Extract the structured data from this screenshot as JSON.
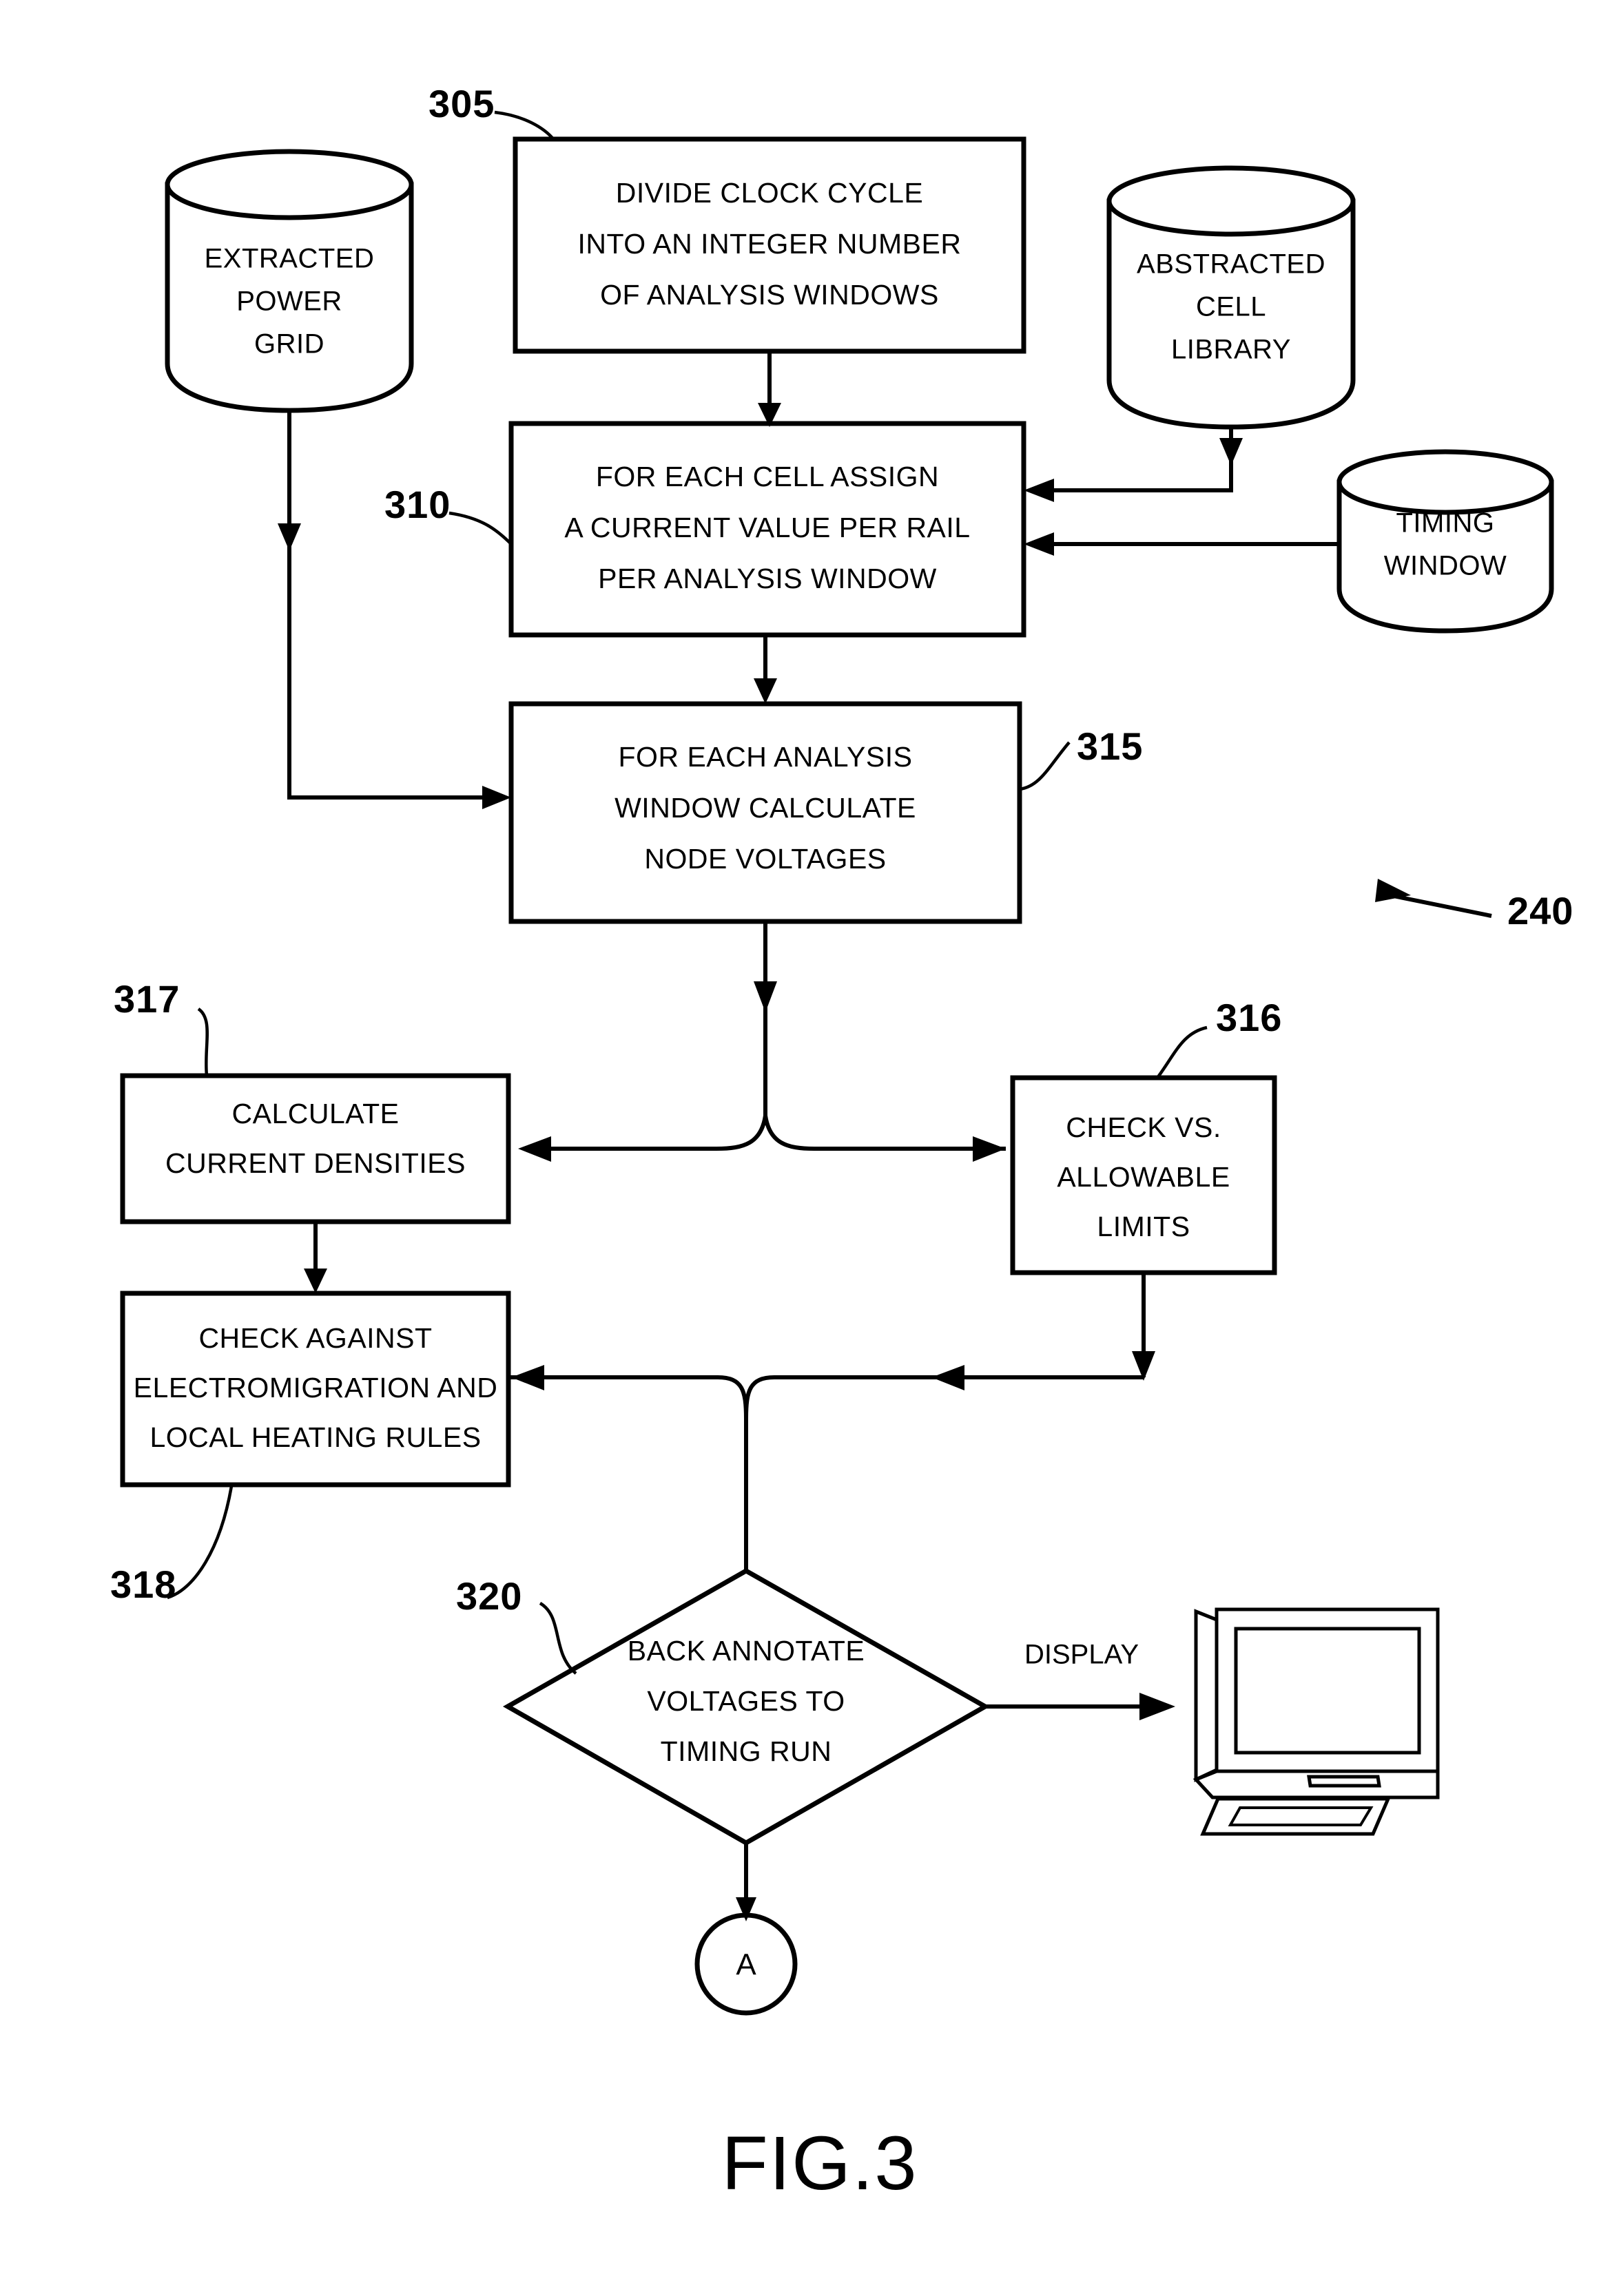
{
  "figure": {
    "caption": "FIG.3",
    "overall_ref": "240"
  },
  "databases": [
    {
      "id": "extracted-power-grid",
      "ref": "",
      "lines": [
        "EXTRACTED",
        "POWER",
        "GRID"
      ]
    },
    {
      "id": "abstracted-cell-library",
      "ref": "",
      "lines": [
        "ABSTRACTED",
        "CELL",
        "LIBRARY"
      ]
    },
    {
      "id": "timing-window",
      "ref": "",
      "lines": [
        "TIMING",
        "WINDOW"
      ]
    }
  ],
  "process_steps": [
    {
      "id": "divide-clock-cycle",
      "ref": "305",
      "lines": [
        "DIVIDE CLOCK CYCLE",
        "INTO AN INTEGER NUMBER",
        "OF ANALYSIS WINDOWS"
      ]
    },
    {
      "id": "assign-current-value",
      "ref": "310",
      "lines": [
        "FOR EACH CELL ASSIGN",
        "A CURRENT VALUE PER RAIL",
        "PER ANALYSIS WINDOW"
      ]
    },
    {
      "id": "calculate-node-voltages",
      "ref": "315",
      "lines": [
        "FOR EACH ANALYSIS",
        "WINDOW CALCULATE",
        "NODE VOLTAGES"
      ]
    },
    {
      "id": "calculate-current-densities",
      "ref": "317",
      "lines": [
        "CALCULATE",
        "CURRENT DENSITIES"
      ]
    },
    {
      "id": "check-vs-allowable-limits",
      "ref": "316",
      "lines": [
        "CHECK VS.",
        "ALLOWABLE",
        "LIMITS"
      ]
    },
    {
      "id": "check-electromigration",
      "ref": "318",
      "lines": [
        "CHECK AGAINST",
        "ELECTROMIGRATION AND",
        "LOCAL HEATING RULES"
      ]
    }
  ],
  "decision": {
    "id": "back-annotate-voltages",
    "ref": "320",
    "lines": [
      "BACK ANNOTATE",
      "VOLTAGES TO",
      "TIMING RUN"
    ]
  },
  "edge_labels": {
    "display": "DISPLAY"
  },
  "connector": {
    "id": "offpage-connector-a",
    "label": "A"
  },
  "monitor": {
    "id": "display-monitor",
    "label": ""
  },
  "colors": {
    "ink": "#000000",
    "paper": "#ffffff"
  }
}
